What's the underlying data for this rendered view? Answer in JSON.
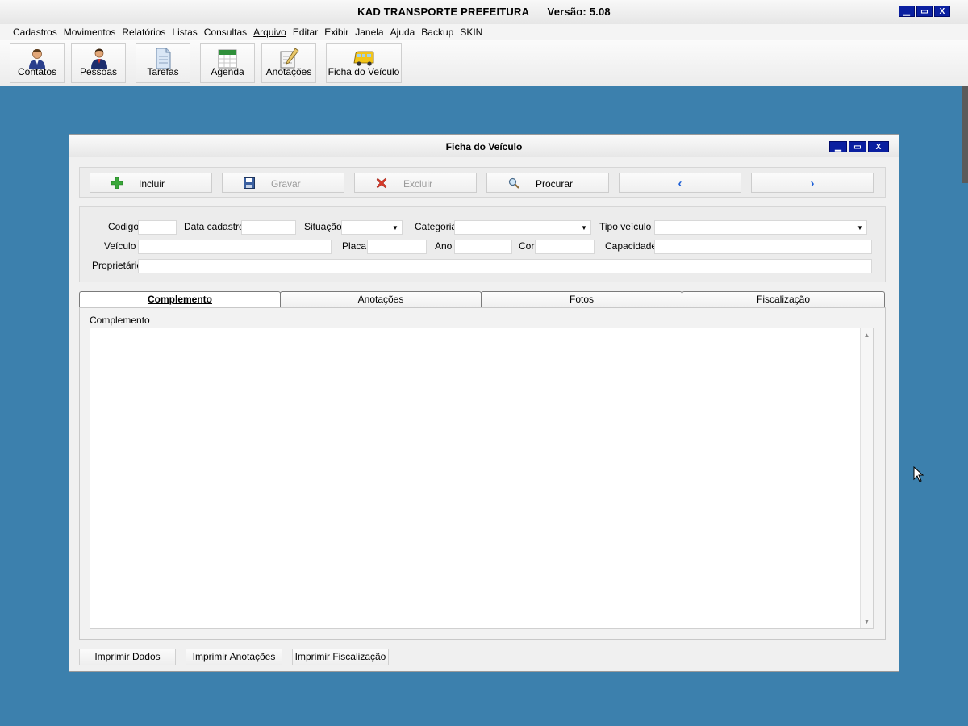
{
  "app": {
    "title": "KAD TRANSPORTE PREFEITURA      Versão: 5.08",
    "window_buttons": [
      "▁",
      "▭",
      "X"
    ]
  },
  "menu": [
    "Cadastros",
    "Movimentos",
    "Relatórios",
    "Listas",
    "Consultas",
    "Arquivo",
    "Editar",
    "Exibir",
    "Janela",
    "Ajuda",
    "Backup",
    "SKIN"
  ],
  "toolbar": {
    "buttons": [
      {
        "label": "Contatos",
        "icon": "person-icon"
      },
      {
        "label": "Pessoas",
        "icon": "people-icon"
      },
      {
        "label": "Tarefas",
        "icon": "document-icon"
      },
      {
        "label": "Agenda",
        "icon": "calendar-icon"
      },
      {
        "label": "Anotações",
        "icon": "notepad-pencil-icon"
      },
      {
        "label": "Ficha do Veículo",
        "icon": "bus-icon"
      }
    ]
  },
  "child": {
    "title": "Ficha do Veículo",
    "window_buttons": [
      "▁",
      "▭",
      "X"
    ],
    "actions": {
      "incluir": "Incluir",
      "gravar": "Gravar",
      "excluir": "Excluir",
      "procurar": "Procurar",
      "prev": "‹",
      "next": "›"
    },
    "form": {
      "codigo_label": "Codigo",
      "codigo_value": "",
      "data_cadastro_label": "Data cadastro",
      "data_cadastro_value": "",
      "situacao_label": "Situação",
      "situacao_value": "",
      "categoria_label": "Categoria",
      "categoria_value": "",
      "tipo_veiculo_label": "Tipo veículo",
      "tipo_veiculo_value": "",
      "veiculo_label": "Veículo",
      "veiculo_value": "",
      "placa_label": "Placa",
      "placa_value": "",
      "ano_label": "Ano",
      "ano_value": "",
      "cor_label": "Cor",
      "cor_value": "",
      "capacidade_label": "Capacidade",
      "capacidade_value": "",
      "proprietario_label": "Proprietário",
      "proprietario_value": ""
    },
    "tabs": [
      "Complemento",
      "Anotações",
      "Fotos",
      "Fiscalização"
    ],
    "active_tab": "Complemento",
    "complemento_label": "Complemento",
    "complemento_value": "",
    "print_buttons": [
      "Imprimir Dados",
      "Imprimir Anotações",
      "Imprimir Fiscalização"
    ]
  },
  "colors": {
    "desktop": "#3c80ad",
    "title_button": "#0a1fa0",
    "nav_arrow": "#1d5fd6",
    "add_icon": "#3aa83a",
    "delete_icon": "#d63a2a"
  }
}
